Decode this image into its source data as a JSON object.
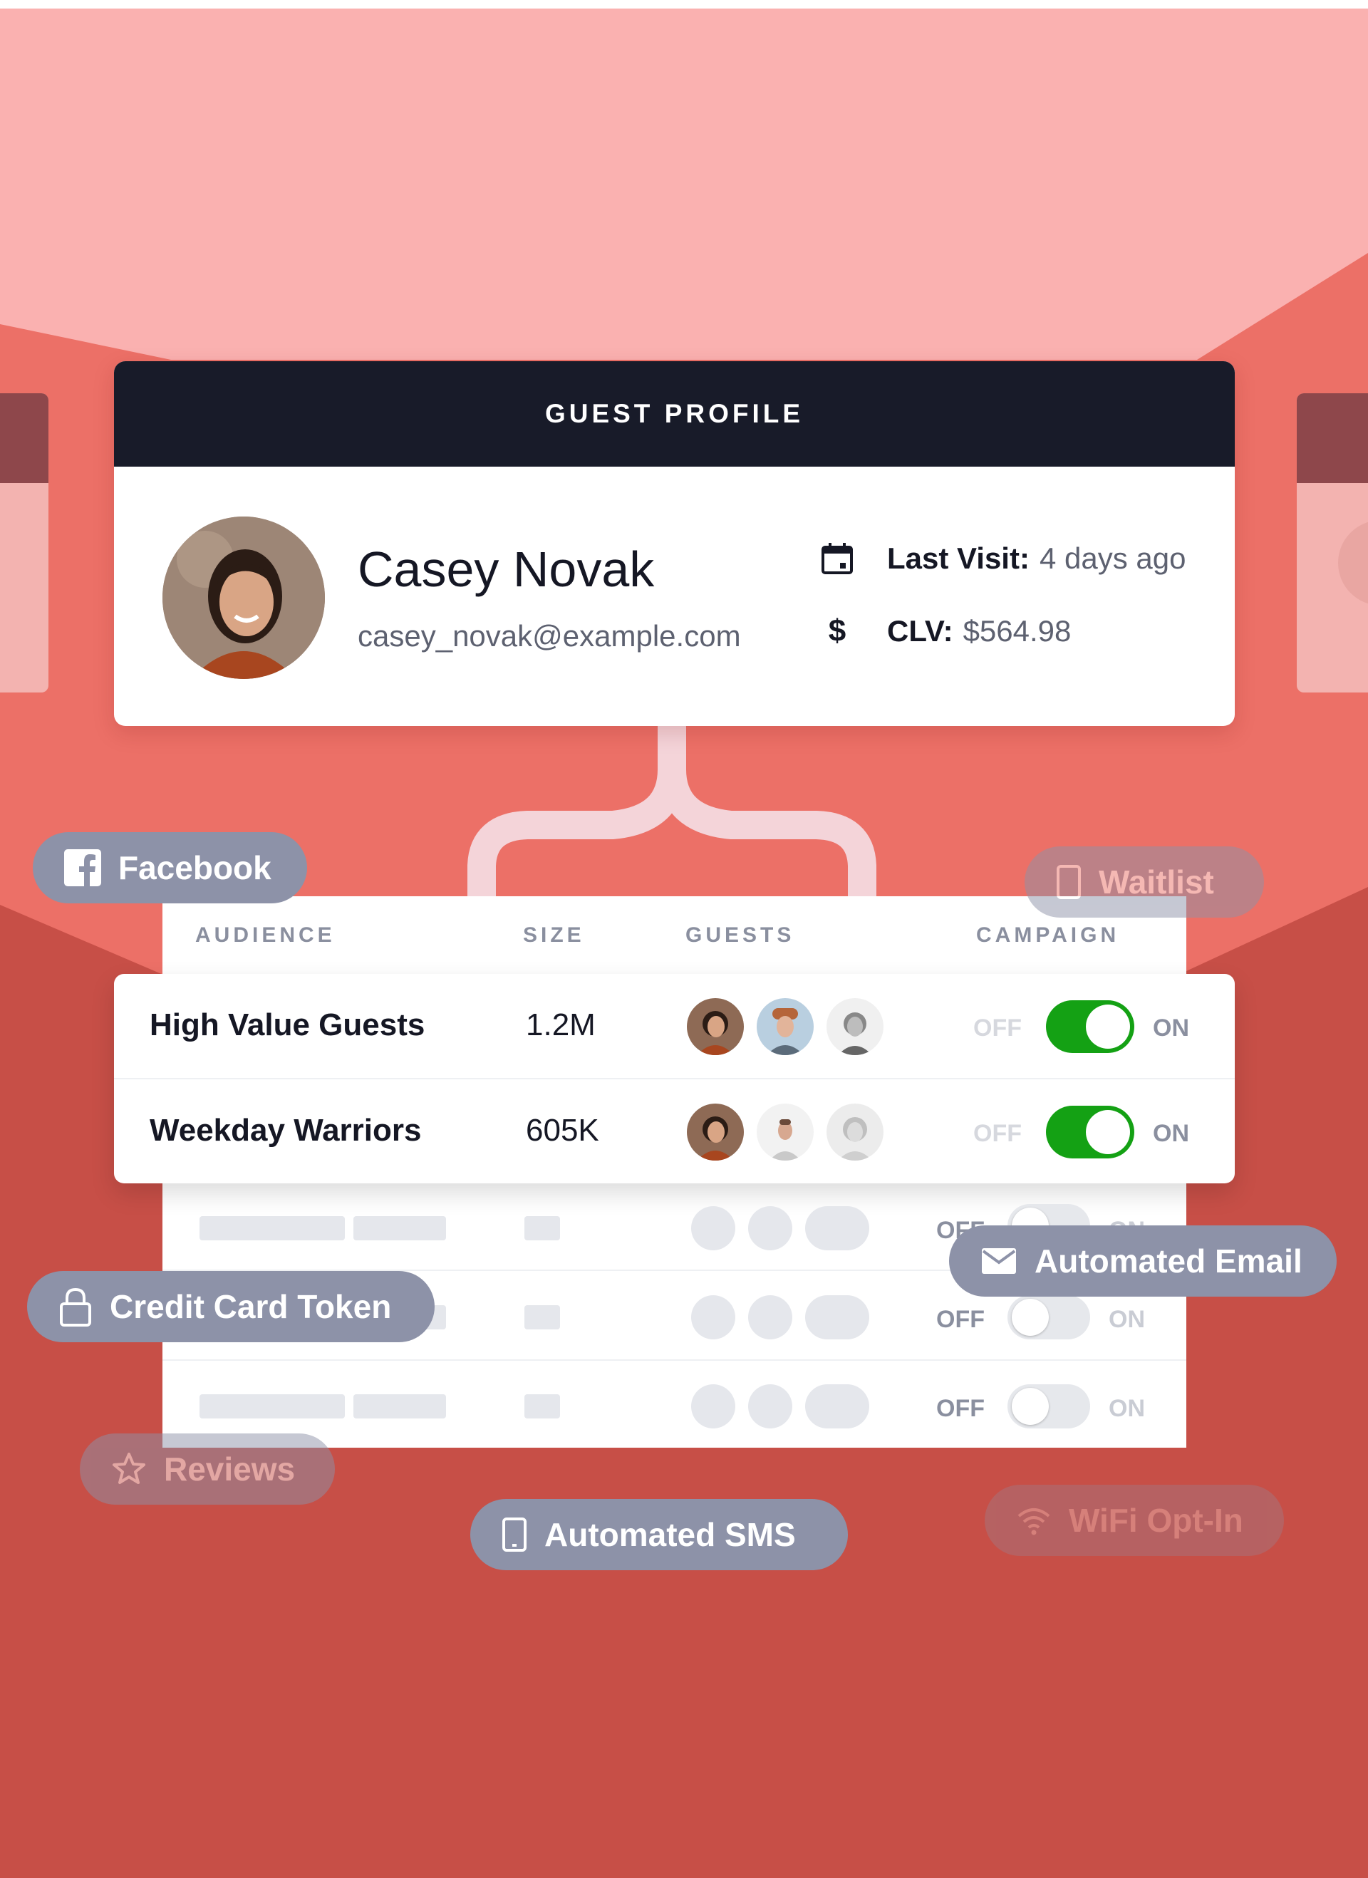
{
  "profile": {
    "header": "GUEST PROFILE",
    "name": "Casey Novak",
    "email": "casey_novak@example.com",
    "last_visit_label": "Last Visit:",
    "last_visit_value": "4 days ago",
    "clv_label": "CLV:",
    "clv_value": "$564.98",
    "icons": [
      "calendar-icon",
      "dollar-icon"
    ]
  },
  "table": {
    "headers": [
      "AUDIENCE",
      "SIZE",
      "GUESTS",
      "CAMPAIGN"
    ],
    "off_label": "OFF",
    "on_label": "ON",
    "rows": [
      {
        "name": "High Value Guests",
        "size": "1.2M",
        "campaign_on": true
      },
      {
        "name": "Weekday Warriors",
        "size": "605K",
        "campaign_on": true
      },
      {
        "campaign_on": false
      },
      {
        "campaign_on": false
      },
      {
        "campaign_on": false
      }
    ]
  },
  "tags": {
    "facebook": "Facebook",
    "waitlist": "Waitlist",
    "automated_email": "Automated Email",
    "credit_card_token": "Credit Card Token",
    "reviews": "Reviews",
    "automated_sms": "Automated SMS",
    "wifi_opt_in": "WiFi Opt-In"
  },
  "colors": {
    "background_top": "#fab1b0",
    "background_mid": "#ec7067",
    "background_bottom": "#c74f47",
    "header_dark": "#181b29",
    "toggle_on": "#14a114",
    "tag_gray": "#8d92a8"
  }
}
